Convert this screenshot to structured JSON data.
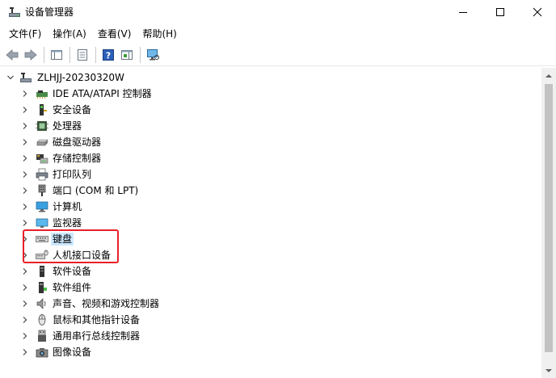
{
  "window": {
    "title": "设备管理器",
    "controls": [
      "minimize",
      "maximize",
      "close"
    ]
  },
  "menu": {
    "items": [
      "文件(F)",
      "操作(A)",
      "查看(V)",
      "帮助(H)"
    ]
  },
  "toolbar": {
    "buttons": [
      "back-icon",
      "forward-icon",
      "properties-icon",
      "view-icon",
      "help-icon",
      "action-icon",
      "monitor-icon"
    ]
  },
  "tree": {
    "root": "ZLHJJ-20230320W",
    "items": [
      {
        "label": "IDE ATA/ATAPI 控制器",
        "icon": "ide-controller-icon"
      },
      {
        "label": "安全设备",
        "icon": "security-device-icon"
      },
      {
        "label": "处理器",
        "icon": "processor-icon"
      },
      {
        "label": "磁盘驱动器",
        "icon": "disk-drive-icon"
      },
      {
        "label": "存储控制器",
        "icon": "storage-controller-icon"
      },
      {
        "label": "打印队列",
        "icon": "print-queue-icon"
      },
      {
        "label": "端口 (COM 和 LPT)",
        "icon": "port-icon"
      },
      {
        "label": "计算机",
        "icon": "computer-icon"
      },
      {
        "label": "监视器",
        "icon": "monitor-icon"
      },
      {
        "label": "键盘",
        "icon": "keyboard-icon"
      },
      {
        "label": "人机接口设备",
        "icon": "hid-icon"
      },
      {
        "label": "软件设备",
        "icon": "software-device-icon"
      },
      {
        "label": "软件组件",
        "icon": "software-component-icon"
      },
      {
        "label": "声音、视频和游戏控制器",
        "icon": "audio-icon"
      },
      {
        "label": "鼠标和其他指针设备",
        "icon": "mouse-icon"
      },
      {
        "label": "通用串行总线控制器",
        "icon": "usb-icon"
      },
      {
        "label": "图像设备",
        "icon": "imaging-device-icon"
      }
    ]
  },
  "colors": {
    "highlight_border": "#e8202a",
    "selection": "#cce8ff"
  }
}
